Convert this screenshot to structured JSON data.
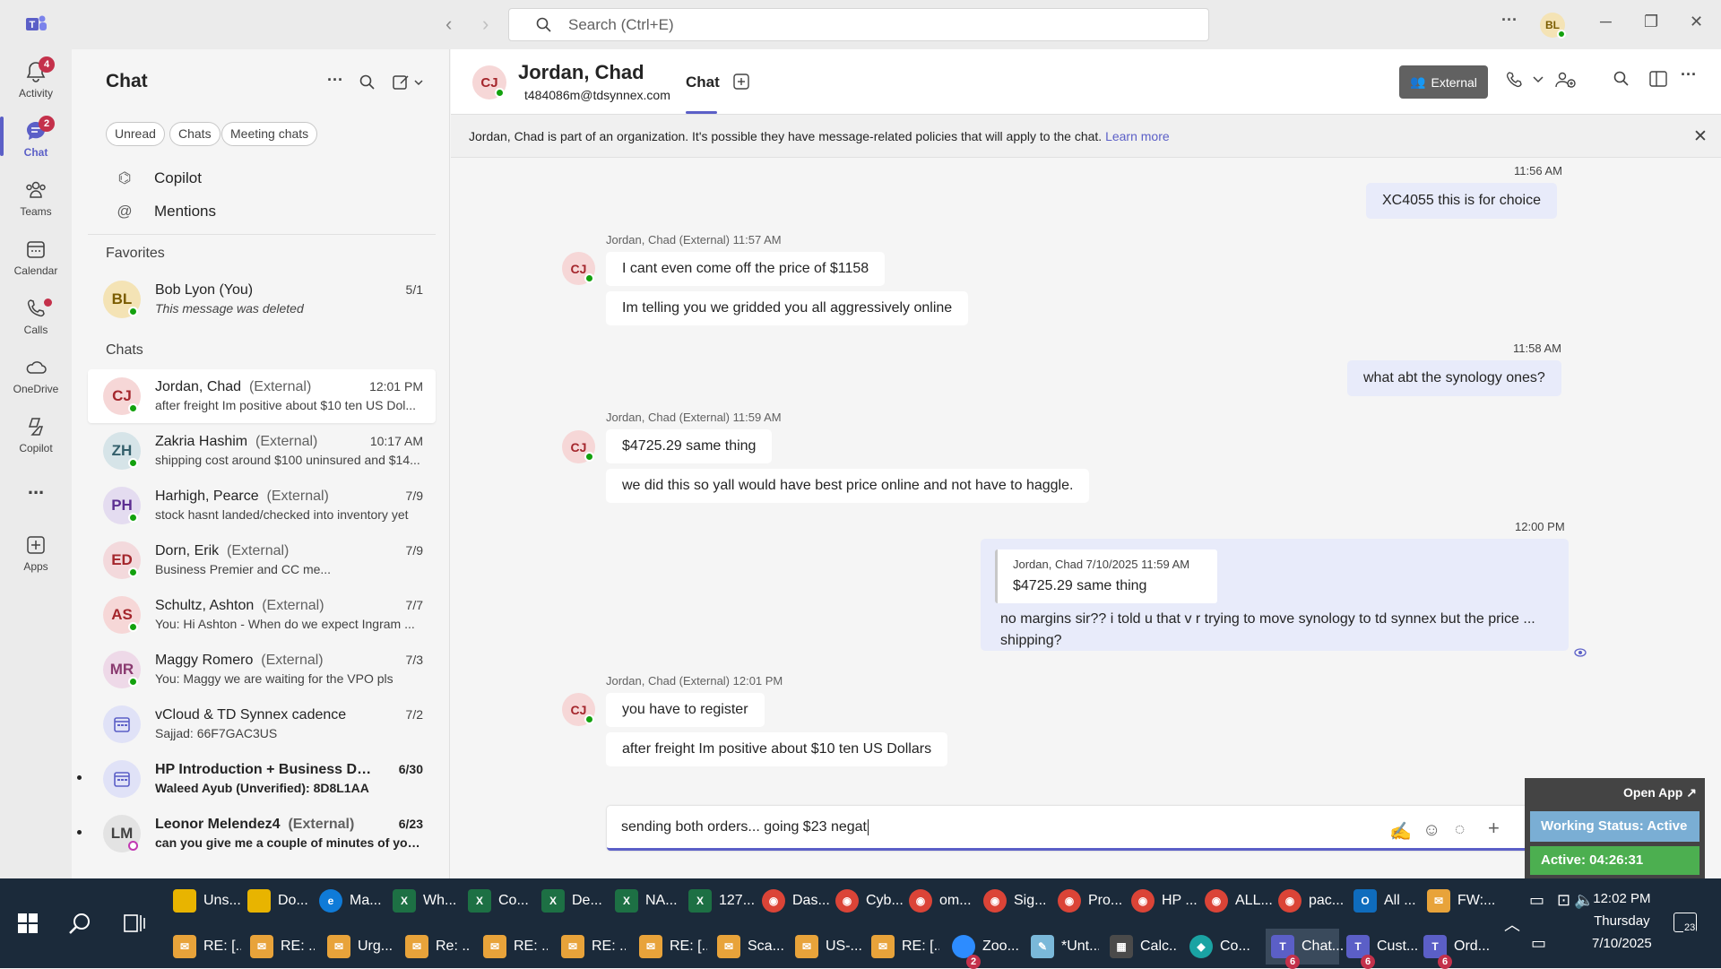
{
  "titlebar": {
    "search_placeholder": "Search (Ctrl+E)",
    "avatar_initials": "BL"
  },
  "rail": {
    "items": [
      {
        "label": "Activity",
        "badge": "4"
      },
      {
        "label": "Chat",
        "badge": "2"
      },
      {
        "label": "Teams"
      },
      {
        "label": "Calendar"
      },
      {
        "label": "Calls"
      },
      {
        "label": "OneDrive"
      },
      {
        "label": "Copilot"
      },
      {
        "label": "..."
      },
      {
        "label": "Apps"
      }
    ]
  },
  "chatlist": {
    "title": "Chat",
    "filters": [
      "Unread",
      "Chats",
      "Meeting chats"
    ],
    "nav": [
      "Copilot",
      "Mentions"
    ],
    "favorites_label": "Favorites",
    "chats_label": "Chats",
    "favorites": [
      {
        "initials": "BL",
        "name": "Bob Lyon (You)",
        "time": "5/1",
        "preview": "This message was deleted"
      }
    ],
    "chats": [
      {
        "initials": "CJ",
        "name": "Jordan, Chad",
        "ext": "(External)",
        "time": "12:01 PM",
        "preview": "after freight Im positive about $10 ten US Dol..."
      },
      {
        "initials": "ZH",
        "name": "Zakria Hashim",
        "ext": "(External)",
        "time": "10:17 AM",
        "preview": "shipping cost around $100 uninsured and $14..."
      },
      {
        "initials": "PH",
        "name": "Harhigh, Pearce",
        "ext": "(External)",
        "time": "7/9",
        "preview": "stock hasnt landed/checked into inventory yet"
      },
      {
        "initials": "ED",
        "name": "Dorn, Erik",
        "ext": "(External)",
        "time": "7/9",
        "preview": "Business Premier and CC me..."
      },
      {
        "initials": "AS",
        "name": "Schultz, Ashton",
        "ext": "(External)",
        "time": "7/7",
        "preview": "You: Hi Ashton -  When do we expect Ingram ..."
      },
      {
        "initials": "MR",
        "name": "Maggy Romero",
        "ext": "(External)",
        "time": "7/3",
        "preview": "You: Maggy we are waiting for the VPO pls"
      },
      {
        "initials": "",
        "name": "vCloud & TD Synnex cadence",
        "ext": "",
        "time": "7/2",
        "preview": "Sajjad: 66F7GAC3US"
      },
      {
        "initials": "",
        "name": "HP Introduction + Business Dis...",
        "ext": "",
        "time": "6/30",
        "preview": "Waleed Ayub (Unverified): 8D8L1AA"
      },
      {
        "initials": "LM",
        "name": "Leonor Melendez4",
        "ext": "(External)",
        "time": "6/23",
        "preview": "can you give me a couple of minutes of your..."
      }
    ]
  },
  "header": {
    "initials": "CJ",
    "name": "Jordan, Chad",
    "email": "t484086m@tdsynnex.com",
    "tab": "Chat",
    "external_label": "External"
  },
  "banner": {
    "text": "Jordan, Chad is part of an organization. It's possible they have message-related policies that will apply to the chat.",
    "link": "Learn more"
  },
  "messages": {
    "m1_time": "11:56 AM",
    "m1_text": "XC4055   this is for choice",
    "g1_meta": "Jordan, Chad (External)  11:57 AM",
    "g1_a": "I cant even come off the price of $1158",
    "g1_b": "Im telling you we gridded you all aggressively online",
    "m2_time": "11:58 AM",
    "m2_text": "what abt the synology ones?",
    "g2_meta": "Jordan, Chad (External)  11:59 AM",
    "g2_a": "$4725.29 same thing",
    "g2_b": "we did this so yall would have best price online and not have to haggle.",
    "m3_time": "12:00 PM",
    "m3_quote_meta": "Jordan, Chad  7/10/2025 11:59 AM",
    "m3_quote_text": "$4725.29 same thing",
    "m3_line1": "no margins sir?? i told u that v r trying to move synology to td synnex but the price ...",
    "m3_line2": "shipping?",
    "g3_meta": "Jordan, Chad (External)  12:01 PM",
    "g3_a": "you have to register",
    "g3_b": "after freight Im positive about $10 ten US Dollars"
  },
  "compose": {
    "text": "sending both orders... going $23 negat"
  },
  "widget": {
    "open_app": "Open App ↗",
    "status": "Working Status: Active",
    "active": "Active: 04:26:31"
  },
  "taskbar": {
    "row1": [
      "Uns...",
      "Do...",
      "Ma...",
      "Wh...",
      "Co...",
      "De...",
      "NA...",
      "127...",
      "Das...",
      "Cyb...",
      "om...",
      "Sig...",
      "Pro...",
      "HP ...",
      "ALL...",
      "pac...",
      "All ...",
      "FW:..."
    ],
    "row2": [
      "RE: [...",
      "RE: ...",
      "Urg...",
      "Re: ...",
      "RE: ...",
      "RE: ...",
      "RE: [...",
      "Sca...",
      "US-...",
      "RE: [...",
      "Zoo...",
      "*Unt...",
      "Calc...",
      "Co...",
      "Chat...",
      "Cust...",
      "Ord..."
    ],
    "time": "12:02 PM",
    "day": "Thursday",
    "date": "7/10/2025",
    "notif": "23",
    "badge_zoom": "2",
    "badge_teams": "6"
  }
}
